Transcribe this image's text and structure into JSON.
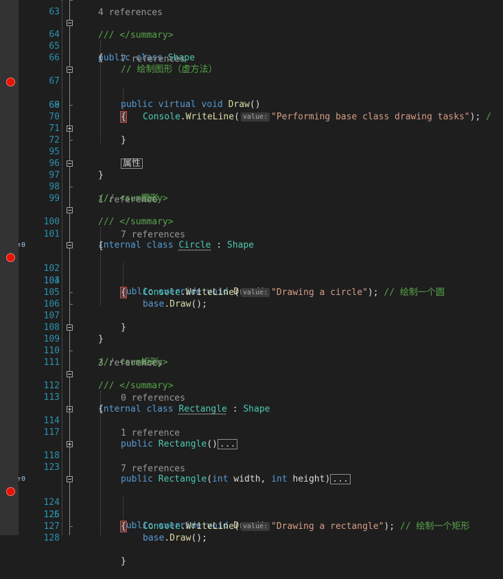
{
  "editor": {
    "line_numbers": {
      "l63": "63",
      "l64": "64",
      "l65": "65",
      "l66": "66",
      "l67": "67",
      "l68": "68",
      "l69": "69",
      "l70": "70",
      "l71": "71",
      "l72": "72",
      "l95": "95",
      "l96": "96",
      "l97": "97",
      "l98": "98",
      "l99": "99",
      "l100": "100",
      "l101": "101",
      "l102": "102",
      "l103": "103",
      "l104": "104",
      "l105": "105",
      "l106": "106",
      "l107": "107",
      "l108": "108",
      "l109": "109",
      "l110": "110",
      "l111": "111",
      "l112": "112",
      "l113": "113",
      "l114": "114",
      "l117": "117",
      "l118": "118",
      "l123": "123",
      "l124": "124",
      "l125": "125",
      "l126": "126",
      "l127": "127",
      "l128": "128"
    },
    "lens": {
      "shape_class": "4 references",
      "shape_draw": "7 references",
      "circle_class": "1 reference",
      "circle_draw": "7 references",
      "rect_class": "3 references",
      "rect_ctor_default": "0 references",
      "rect_ctor_params": "1 reference",
      "rect_draw": "7 references"
    },
    "inheritance_glyphs": {
      "circle_draw": "↑0",
      "rect_draw": "↑0"
    },
    "tokens": {
      "summary_close": "/// </summary>",
      "public": "public",
      "internal": "internal",
      "class": "class",
      "virtual": "virtual",
      "override": "override",
      "void": "void",
      "int": "int",
      "shape": "Shape",
      "circle": "Circle",
      "rectangle": "Rectangle",
      "draw": "Draw",
      "console": "Console",
      "writeline": "WriteLine",
      "base": "base",
      "width": "width",
      "height": "height",
      "value_hint": "value:",
      "open_brace": "{",
      "close_brace": "}",
      "paren_empty": "()",
      "colon": " : ",
      "comment_draw_shape": "// 绘制图形（虚方法）",
      "region_properties": "属性",
      "doc_summary_open": "/// <summary>",
      "doc_circle": "///     圆形",
      "doc_rect": "///     矩形",
      "str_base": "\"Performing base class drawing tasks\"",
      "str_circle": "\"Drawing a circle\"",
      "str_rect": "\"Drawing a rectangle\"",
      "comment_circle": "// 绘制一个圆",
      "comment_rect": "// 绘制一个矩形",
      "ellipsis": "...",
      "trailing_slash": "/"
    }
  }
}
